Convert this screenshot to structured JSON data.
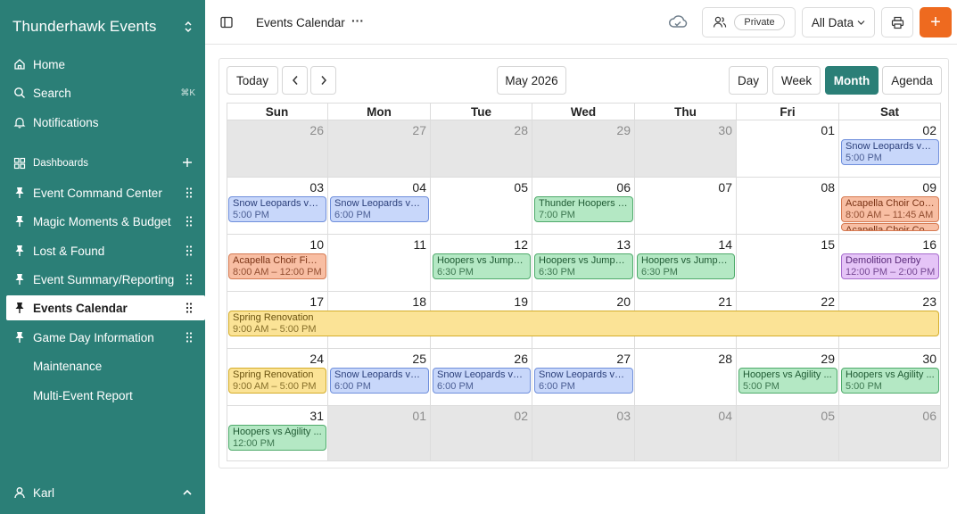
{
  "sidebar": {
    "brand": "Thunderhawk Events",
    "items": [
      {
        "label": "Home",
        "icon": "home-icon"
      },
      {
        "label": "Search",
        "icon": "search-icon",
        "shortcut": "⌘K"
      },
      {
        "label": "Notifications",
        "icon": "bell-icon"
      }
    ],
    "dashboards_label": "Dashboards",
    "pinned": [
      {
        "label": "Event Command Center"
      },
      {
        "label": "Magic Moments & Budget"
      },
      {
        "label": "Lost & Found"
      },
      {
        "label": "Event Summary/Reporting"
      },
      {
        "label": "Events Calendar",
        "active": true
      },
      {
        "label": "Game Day Information"
      }
    ],
    "plain": [
      {
        "label": "Maintenance"
      },
      {
        "label": "Multi-Event Report"
      }
    ],
    "user": "Karl"
  },
  "topbar": {
    "title": "Events Calendar",
    "more": "···",
    "privacy": "Private",
    "data_filter": "All Data",
    "add": "+"
  },
  "calendar": {
    "today": "Today",
    "month_label": "May 2026",
    "views": [
      "Day",
      "Week",
      "Month",
      "Agenda"
    ],
    "active_view": "Month",
    "weekdays": [
      "Sun",
      "Mon",
      "Tue",
      "Wed",
      "Thu",
      "Fri",
      "Sat"
    ],
    "weeks": [
      [
        {
          "d": "26",
          "o": true
        },
        {
          "d": "27",
          "o": true
        },
        {
          "d": "28",
          "o": true
        },
        {
          "d": "29",
          "o": true
        },
        {
          "d": "30",
          "o": true
        },
        {
          "d": "01"
        },
        {
          "d": "02"
        }
      ],
      [
        {
          "d": "03"
        },
        {
          "d": "04"
        },
        {
          "d": "05"
        },
        {
          "d": "06"
        },
        {
          "d": "07"
        },
        {
          "d": "08"
        },
        {
          "d": "09"
        }
      ],
      [
        {
          "d": "10"
        },
        {
          "d": "11"
        },
        {
          "d": "12"
        },
        {
          "d": "13"
        },
        {
          "d": "14"
        },
        {
          "d": "15"
        },
        {
          "d": "16"
        }
      ],
      [
        {
          "d": "17"
        },
        {
          "d": "18"
        },
        {
          "d": "19"
        },
        {
          "d": "20"
        },
        {
          "d": "21"
        },
        {
          "d": "22"
        },
        {
          "d": "23"
        }
      ],
      [
        {
          "d": "24"
        },
        {
          "d": "25"
        },
        {
          "d": "26"
        },
        {
          "d": "27"
        },
        {
          "d": "28"
        },
        {
          "d": "29"
        },
        {
          "d": "30"
        }
      ],
      [
        {
          "d": "31"
        },
        {
          "d": "01",
          "o": true
        },
        {
          "d": "02",
          "o": true
        },
        {
          "d": "03",
          "o": true
        },
        {
          "d": "04",
          "o": true
        },
        {
          "d": "05",
          "o": true
        },
        {
          "d": "06",
          "o": true
        }
      ]
    ],
    "events": [
      {
        "week": 0,
        "day": 6,
        "span": 1,
        "slot": 0,
        "title": "Snow Leopards vs. ...",
        "time": "5:00 PM",
        "color": "blue"
      },
      {
        "week": 1,
        "day": 0,
        "span": 1,
        "slot": 0,
        "title": "Snow Leopards vs. ...",
        "time": "5:00 PM",
        "color": "blue"
      },
      {
        "week": 1,
        "day": 1,
        "span": 1,
        "slot": 0,
        "title": "Snow Leopards vs. ...",
        "time": "6:00 PM",
        "color": "blue"
      },
      {
        "week": 1,
        "day": 3,
        "span": 1,
        "slot": 0,
        "title": "Thunder Hoopers v...",
        "time": "7:00 PM",
        "color": "green"
      },
      {
        "week": 1,
        "day": 6,
        "span": 1,
        "slot": 0,
        "title": "Acapella Choir Com...",
        "time": "8:00 AM – 11:45 AM",
        "color": "orange"
      },
      {
        "week": 1,
        "day": 6,
        "span": 1,
        "slot": 1,
        "title": "Acapella Choir Com...",
        "time": "",
        "color": "orange",
        "clip": true
      },
      {
        "week": 2,
        "day": 0,
        "span": 1,
        "slot": 0,
        "title": "Acapella Choir Finals",
        "time": "8:00 AM – 12:00 PM",
        "color": "orange"
      },
      {
        "week": 2,
        "day": 2,
        "span": 1,
        "slot": 0,
        "title": "Hoopers vs Jumper...",
        "time": "6:30 PM",
        "color": "green"
      },
      {
        "week": 2,
        "day": 3,
        "span": 1,
        "slot": 0,
        "title": "Hoopers vs Jumper...",
        "time": "6:30 PM",
        "color": "green"
      },
      {
        "week": 2,
        "day": 4,
        "span": 1,
        "slot": 0,
        "title": "Hoopers vs Jumper...",
        "time": "6:30 PM",
        "color": "green"
      },
      {
        "week": 2,
        "day": 6,
        "span": 1,
        "slot": 0,
        "title": "Demolition Derby",
        "time": "12:00 PM – 2:00 PM",
        "color": "purple"
      },
      {
        "week": 3,
        "day": 0,
        "span": 7,
        "slot": 0,
        "title": "Spring Renovation",
        "time": "9:00 AM – 5:00 PM",
        "color": "yellow"
      },
      {
        "week": 4,
        "day": 0,
        "span": 1,
        "slot": 0,
        "title": "Spring Renovation",
        "time": "9:00 AM – 5:00 PM",
        "color": "yellow"
      },
      {
        "week": 4,
        "day": 1,
        "span": 1,
        "slot": 0,
        "title": "Snow Leopards vs. L...",
        "time": "6:00 PM",
        "color": "blue"
      },
      {
        "week": 4,
        "day": 2,
        "span": 1,
        "slot": 0,
        "title": "Snow Leopards vs. L...",
        "time": "6:00 PM",
        "color": "blue"
      },
      {
        "week": 4,
        "day": 3,
        "span": 1,
        "slot": 0,
        "title": "Snow Leopards vs. L...",
        "time": "6:00 PM",
        "color": "blue"
      },
      {
        "week": 4,
        "day": 5,
        "span": 1,
        "slot": 0,
        "title": "Hoopers vs Agility ...",
        "time": "5:00 PM",
        "color": "green"
      },
      {
        "week": 4,
        "day": 6,
        "span": 1,
        "slot": 0,
        "title": "Hoopers vs Agility ...",
        "time": "5:00 PM",
        "color": "green"
      },
      {
        "week": 5,
        "day": 0,
        "span": 1,
        "slot": 0,
        "title": "Hoopers vs Agility ...",
        "time": "12:00 PM",
        "color": "green"
      }
    ]
  }
}
